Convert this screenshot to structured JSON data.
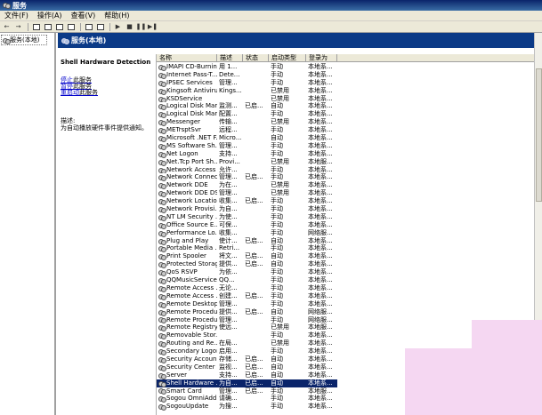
{
  "window": {
    "title": "服务"
  },
  "menu": [
    "文件(F)",
    "操作(A)",
    "查看(V)",
    "帮助(H)"
  ],
  "tree": {
    "root_label": "服务(本地)"
  },
  "panel": {
    "header": "服务(本地)"
  },
  "detail": {
    "service_name": "Shell Hardware Detection",
    "links": [
      {
        "link": "停止",
        "rest": "此服务"
      },
      {
        "link": "暂停",
        "rest": "此服务"
      },
      {
        "link": "重启动",
        "rest": "此服务"
      }
    ],
    "desc_label": "描述:",
    "desc_text": "为自动播放硬件事件提供通知。"
  },
  "columns": [
    "名称",
    "描述",
    "状态",
    "启动类型",
    "登录为"
  ],
  "services": [
    {
      "name": "IMAPI CD-Burnin...",
      "desc": "用 1...",
      "status": "",
      "startup": "手动",
      "logon": "本地系..."
    },
    {
      "name": "Internet Pass-T...",
      "desc": "Dete...",
      "status": "",
      "startup": "手动",
      "logon": "本地系..."
    },
    {
      "name": "IPSEC Services",
      "desc": "管理...",
      "status": "",
      "startup": "手动",
      "logon": "本地系..."
    },
    {
      "name": "Kingsoft Antiviru...",
      "desc": "Kings...",
      "status": "",
      "startup": "已禁用",
      "logon": "本地系..."
    },
    {
      "name": "KSDService",
      "desc": "",
      "status": "",
      "startup": "已禁用",
      "logon": "本地系..."
    },
    {
      "name": "Logical Disk Man...",
      "desc": "监测...",
      "status": "已启...",
      "startup": "自动",
      "logon": "本地系..."
    },
    {
      "name": "Logical Disk Man...",
      "desc": "配置...",
      "status": "",
      "startup": "手动",
      "logon": "本地系..."
    },
    {
      "name": "Messenger",
      "desc": "传输...",
      "status": "",
      "startup": "已禁用",
      "logon": "本地系..."
    },
    {
      "name": "METrsptSvr",
      "desc": "远程...",
      "status": "",
      "startup": "手动",
      "logon": "本地系..."
    },
    {
      "name": "Microsoft .NET F...",
      "desc": "Micro...",
      "status": "",
      "startup": "自动",
      "logon": "本地系..."
    },
    {
      "name": "MS Software Sh...",
      "desc": "管理...",
      "status": "",
      "startup": "手动",
      "logon": "本地系..."
    },
    {
      "name": "Net Logon",
      "desc": "支持...",
      "status": "",
      "startup": "手动",
      "logon": "本地系..."
    },
    {
      "name": "Net.Tcp Port Sh...",
      "desc": "Provi...",
      "status": "",
      "startup": "已禁用",
      "logon": "本地服..."
    },
    {
      "name": "Network Access ...",
      "desc": "允许...",
      "status": "",
      "startup": "手动",
      "logon": "本地系..."
    },
    {
      "name": "Network Connec...",
      "desc": "管理...",
      "status": "已启...",
      "startup": "手动",
      "logon": "本地系..."
    },
    {
      "name": "Network DDE",
      "desc": "为在...",
      "status": "",
      "startup": "已禁用",
      "logon": "本地系..."
    },
    {
      "name": "Network DDE DS...",
      "desc": "管理...",
      "status": "",
      "startup": "已禁用",
      "logon": "本地系..."
    },
    {
      "name": "Network Locatio...",
      "desc": "收集...",
      "status": "已启...",
      "startup": "手动",
      "logon": "本地系..."
    },
    {
      "name": "Network Provisi...",
      "desc": "为自...",
      "status": "",
      "startup": "手动",
      "logon": "本地系..."
    },
    {
      "name": "NT LM Security ...",
      "desc": "为使...",
      "status": "",
      "startup": "手动",
      "logon": "本地系..."
    },
    {
      "name": "Office Source E...",
      "desc": "可保...",
      "status": "",
      "startup": "手动",
      "logon": "本地系..."
    },
    {
      "name": "Performance Lo...",
      "desc": "收集...",
      "status": "",
      "startup": "手动",
      "logon": "网络服..."
    },
    {
      "name": "Plug and Play",
      "desc": "使计...",
      "status": "已启...",
      "startup": "自动",
      "logon": "本地系..."
    },
    {
      "name": "Portable Media ...",
      "desc": "Retri...",
      "status": "",
      "startup": "手动",
      "logon": "本地系..."
    },
    {
      "name": "Print Spooler",
      "desc": "将文...",
      "status": "已启...",
      "startup": "自动",
      "logon": "本地系..."
    },
    {
      "name": "Protected Storage",
      "desc": "提供...",
      "status": "已启...",
      "startup": "自动",
      "logon": "本地系..."
    },
    {
      "name": "QoS RSVP",
      "desc": "为依...",
      "status": "",
      "startup": "手动",
      "logon": "本地系..."
    },
    {
      "name": "QQMusicService",
      "desc": "QQ...",
      "status": "",
      "startup": "手动",
      "logon": "本地系..."
    },
    {
      "name": "Remote Access ...",
      "desc": "无论...",
      "status": "",
      "startup": "手动",
      "logon": "本地系..."
    },
    {
      "name": "Remote Access ...",
      "desc": "创建...",
      "status": "已启...",
      "startup": "手动",
      "logon": "本地系..."
    },
    {
      "name": "Remote Desktop...",
      "desc": "管理...",
      "status": "",
      "startup": "手动",
      "logon": "本地系..."
    },
    {
      "name": "Remote Procedu...",
      "desc": "提供...",
      "status": "已启...",
      "startup": "自动",
      "logon": "网络服..."
    },
    {
      "name": "Remote Procedu...",
      "desc": "管理...",
      "status": "",
      "startup": "手动",
      "logon": "网络服..."
    },
    {
      "name": "Remote Registry",
      "desc": "使远...",
      "status": "",
      "startup": "已禁用",
      "logon": "本地服..."
    },
    {
      "name": "Removable Stor...",
      "desc": "",
      "status": "",
      "startup": "手动",
      "logon": "本地系..."
    },
    {
      "name": "Routing and Re...",
      "desc": "在局...",
      "status": "",
      "startup": "已禁用",
      "logon": "本地系..."
    },
    {
      "name": "Secondary Logon",
      "desc": "启用...",
      "status": "",
      "startup": "手动",
      "logon": "本地系..."
    },
    {
      "name": "Security Accoun...",
      "desc": "存储...",
      "status": "已启...",
      "startup": "自动",
      "logon": "本地系..."
    },
    {
      "name": "Security Center",
      "desc": "监视...",
      "status": "已启...",
      "startup": "自动",
      "logon": "本地系..."
    },
    {
      "name": "Server",
      "desc": "支持...",
      "status": "已启...",
      "startup": "自动",
      "logon": "本地系..."
    },
    {
      "name": "Shell Hardware ...",
      "desc": "为自...",
      "status": "已启...",
      "startup": "自动",
      "logon": "本地系...",
      "selected": true
    },
    {
      "name": "Smart Card",
      "desc": "管理...",
      "status": "已启...",
      "startup": "手动",
      "logon": "本地服..."
    },
    {
      "name": "Sogou OmniAdd...",
      "desc": "请确...",
      "status": "",
      "startup": "手动",
      "logon": "本地系..."
    },
    {
      "name": "SogouUpdate",
      "desc": "为搜...",
      "status": "",
      "startup": "手动",
      "logon": "本地系..."
    }
  ]
}
